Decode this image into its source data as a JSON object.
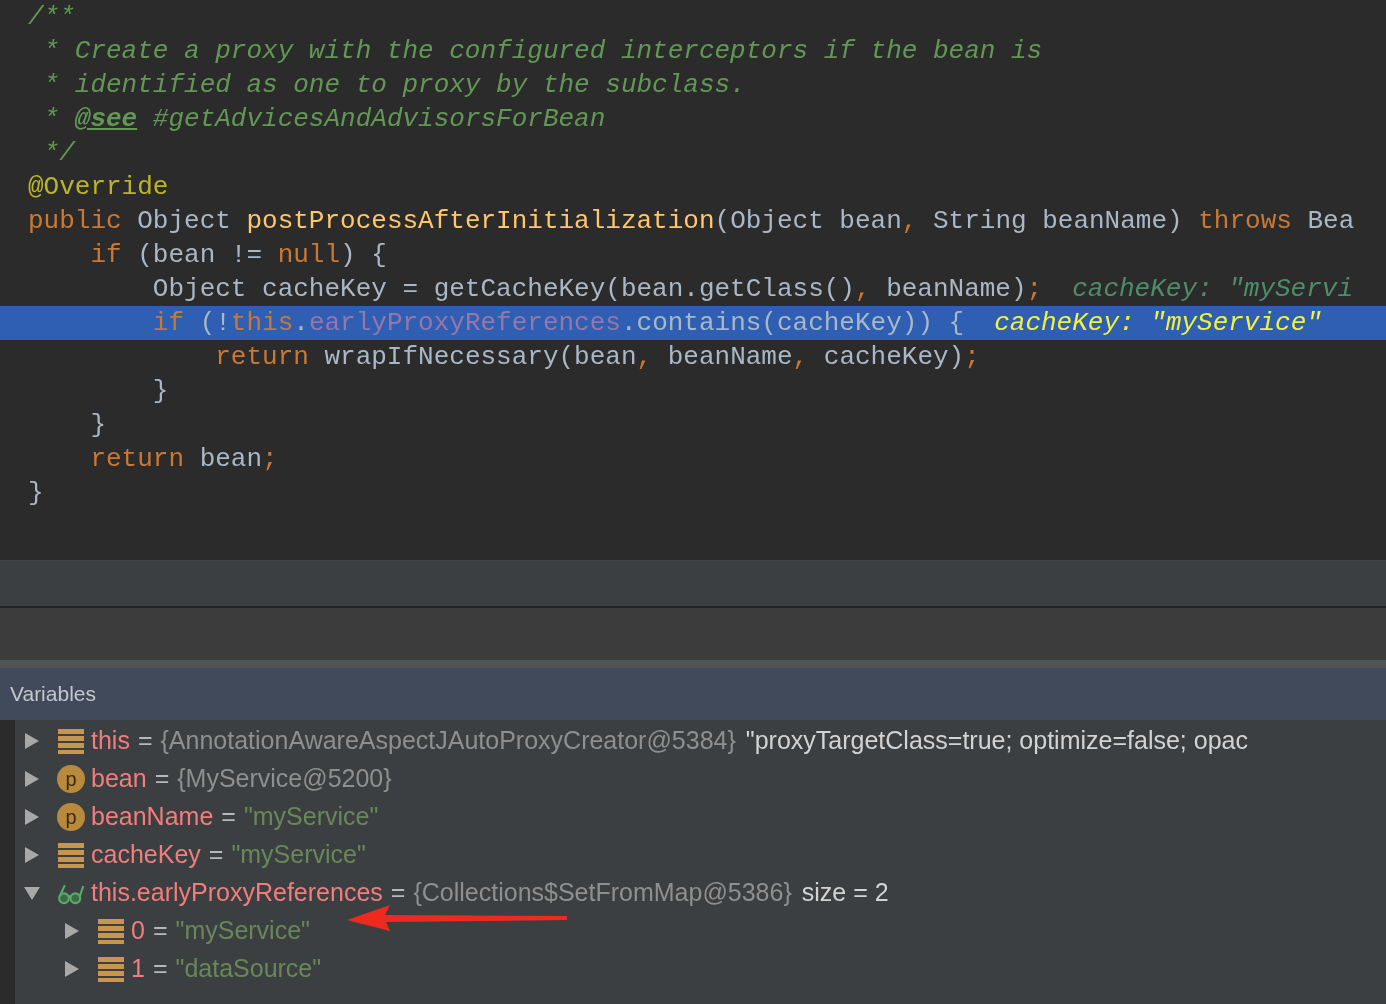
{
  "editor": {
    "lines": [
      {
        "execution_point": false,
        "tokens": [
          {
            "kind": "comment",
            "text": "/**"
          }
        ]
      },
      {
        "execution_point": false,
        "tokens": [
          {
            "kind": "comment",
            "text": " * Create a proxy with the configured interceptors if the bean is"
          }
        ]
      },
      {
        "execution_point": false,
        "tokens": [
          {
            "kind": "comment",
            "text": " * identified as one to proxy by the subclass."
          }
        ]
      },
      {
        "execution_point": false,
        "tokens": [
          {
            "kind": "comment",
            "text": " * "
          },
          {
            "kind": "doctag",
            "text": "@see"
          },
          {
            "kind": "comment",
            "text": " #getAdvicesAndAdvisorsForBean"
          }
        ]
      },
      {
        "execution_point": false,
        "tokens": [
          {
            "kind": "comment",
            "text": " */"
          }
        ]
      },
      {
        "execution_point": false,
        "tokens": [
          {
            "kind": "annotation",
            "text": "@Override"
          }
        ]
      },
      {
        "execution_point": false,
        "tokens": [
          {
            "kind": "keyword",
            "text": "public"
          },
          {
            "kind": "plain",
            "text": " Object "
          },
          {
            "kind": "method",
            "text": "postProcessAfterInitialization"
          },
          {
            "kind": "plain",
            "text": "(Object bean"
          },
          {
            "kind": "keyword",
            "text": ","
          },
          {
            "kind": "plain",
            "text": " String beanName) "
          },
          {
            "kind": "keyword",
            "text": "throws"
          },
          {
            "kind": "plain",
            "text": " Bea"
          }
        ]
      },
      {
        "execution_point": false,
        "tokens": [
          {
            "kind": "keyword",
            "text": "    if"
          },
          {
            "kind": "plain",
            "text": " (bean != "
          },
          {
            "kind": "keyword",
            "text": "null"
          },
          {
            "kind": "plain",
            "text": ") {"
          }
        ]
      },
      {
        "execution_point": false,
        "tokens": [
          {
            "kind": "plain",
            "text": "        Object cacheKey = getCacheKey(bean.getClass()"
          },
          {
            "kind": "keyword",
            "text": ","
          },
          {
            "kind": "plain",
            "text": " beanName)"
          },
          {
            "kind": "keyword",
            "text": ";"
          }
        ],
        "hint": "cacheKey: \"myServi"
      },
      {
        "execution_point": true,
        "tokens": [
          {
            "kind": "keyword",
            "text": "        if"
          },
          {
            "kind": "plain",
            "text": " (!"
          },
          {
            "kind": "keyword",
            "text": "this"
          },
          {
            "kind": "plain",
            "text": "."
          },
          {
            "kind": "field",
            "text": "earlyProxyReferences"
          },
          {
            "kind": "plain",
            "text": ".contains(cacheKey)) {"
          }
        ],
        "hint": "cacheKey: \"myService\""
      },
      {
        "execution_point": false,
        "tokens": [
          {
            "kind": "keyword",
            "text": "            return"
          },
          {
            "kind": "plain",
            "text": " wrapIfNecessary(bean"
          },
          {
            "kind": "keyword",
            "text": ","
          },
          {
            "kind": "plain",
            "text": " beanName"
          },
          {
            "kind": "keyword",
            "text": ","
          },
          {
            "kind": "plain",
            "text": " cacheKey)"
          },
          {
            "kind": "keyword",
            "text": ";"
          }
        ]
      },
      {
        "execution_point": false,
        "tokens": [
          {
            "kind": "plain",
            "text": "        }"
          }
        ]
      },
      {
        "execution_point": false,
        "tokens": [
          {
            "kind": "plain",
            "text": "    }"
          }
        ]
      },
      {
        "execution_point": false,
        "tokens": [
          {
            "kind": "keyword",
            "text": "    return"
          },
          {
            "kind": "plain",
            "text": " bean"
          },
          {
            "kind": "keyword",
            "text": ";"
          }
        ]
      },
      {
        "execution_point": false,
        "tokens": [
          {
            "kind": "plain",
            "text": "}"
          }
        ]
      }
    ]
  },
  "variables": {
    "title": "Variables",
    "items": [
      {
        "kind": "field",
        "name": "this",
        "operator": "=",
        "value": "{AnnotationAwareAspectJAutoProxyCreator@5384}",
        "string_value": false,
        "extra": "\"proxyTargetClass=true; optimize=false; opac",
        "expanded": false
      },
      {
        "kind": "param",
        "badge": "p",
        "name": "bean",
        "operator": "=",
        "value": "{MyService@5200}",
        "string_value": false,
        "expanded": false
      },
      {
        "kind": "param",
        "badge": "p",
        "name": "beanName",
        "operator": "=",
        "value": "\"myService\"",
        "string_value": true,
        "expanded": false
      },
      {
        "kind": "field",
        "name": "cacheKey",
        "operator": "=",
        "value": "\"myService\"",
        "string_value": true,
        "expanded": false
      },
      {
        "kind": "watch",
        "name": "this.earlyProxyReferences",
        "operator": "=",
        "value": "{Collections$SetFromMap@5386}",
        "string_value": false,
        "extra": "size = 2",
        "expanded": true,
        "children": [
          {
            "kind": "field",
            "name": "0",
            "operator": "=",
            "value": "\"myService\"",
            "string_value": true,
            "expanded": false
          },
          {
            "kind": "field",
            "name": "1",
            "operator": "=",
            "value": "\"dataSource\"",
            "string_value": true,
            "expanded": false
          }
        ]
      }
    ]
  }
}
